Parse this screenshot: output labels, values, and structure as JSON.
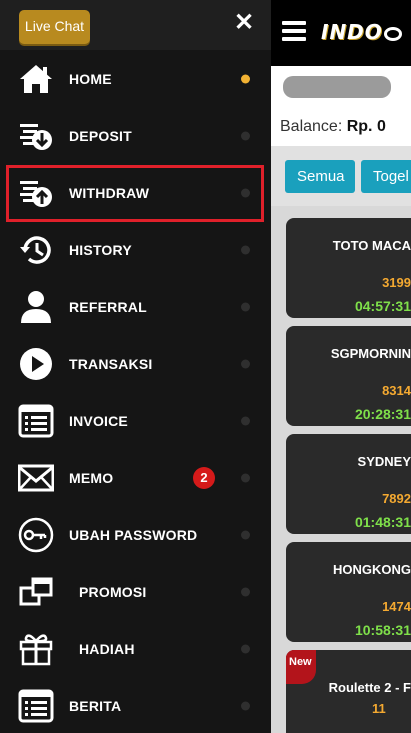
{
  "drawer": {
    "live_chat_label": "Live Chat",
    "close_symbol": "✕",
    "menu": [
      {
        "label": "HOME",
        "icon": "home-icon",
        "active": true
      },
      {
        "label": "DEPOSIT",
        "icon": "deposit-icon"
      },
      {
        "label": "WITHDRAW",
        "icon": "withdraw-icon",
        "highlighted": true
      },
      {
        "label": "HISTORY",
        "icon": "history-icon"
      },
      {
        "label": "REFERRAL",
        "icon": "user-icon"
      },
      {
        "label": "TRANSAKSI",
        "icon": "play-icon"
      },
      {
        "label": "INVOICE",
        "icon": "invoice-icon"
      },
      {
        "label": "MEMO",
        "icon": "envelope-icon",
        "badge": "2"
      },
      {
        "label": "UBAH PASSWORD",
        "icon": "key-icon"
      },
      {
        "label": "PROMOSI",
        "icon": "promo-icon"
      },
      {
        "label": "HADIAH",
        "icon": "gift-icon"
      },
      {
        "label": "BERITA",
        "icon": "news-icon"
      }
    ]
  },
  "header": {
    "logo_text": "INDO",
    "balance_label": "Balance:",
    "balance_value": "Rp. 0"
  },
  "filters": [
    "Semua",
    "Togel"
  ],
  "cards": [
    {
      "title": "TOTO MACA",
      "result": "3199",
      "time": "04:57:31"
    },
    {
      "title": "SGPMORNIN",
      "result": "8314",
      "time": "20:28:31"
    },
    {
      "title": "SYDNEY",
      "result": "7892",
      "time": "01:48:31"
    },
    {
      "title": "HONGKONG",
      "result": "1474",
      "time": "10:58:31"
    },
    {
      "badge": "New",
      "title": "Roulette 2 - F",
      "result": "11"
    }
  ],
  "colors": {
    "accent_gold": "#f2b233",
    "filter_teal": "#1aa0bd",
    "highlight_red": "#e0202a",
    "result_orange": "#f4a931",
    "time_green": "#7fe04a"
  }
}
